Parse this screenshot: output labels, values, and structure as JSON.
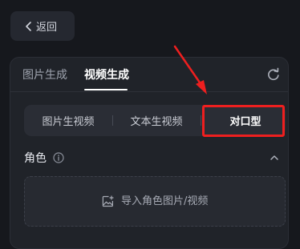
{
  "back_button": {
    "label": "返回",
    "icon": "chevron-left-icon"
  },
  "mode_tabs": [
    {
      "label": "图片生成",
      "active": false
    },
    {
      "label": "视频生成",
      "active": true
    }
  ],
  "refresh_icon": "refresh-icon",
  "sub_tabs": [
    {
      "label": "图片生视频",
      "active": false
    },
    {
      "label": "文本生视频",
      "active": false
    },
    {
      "label": "对口型",
      "active": true
    }
  ],
  "role_section": {
    "label": "角色",
    "info_icon": "info-icon",
    "collapse_icon": "chevron-up-icon",
    "upload_label": "导入角色图片/视频",
    "upload_icon": "image-add-icon"
  },
  "annotation": {
    "color": "#ee1f1f",
    "target": "对口型"
  }
}
